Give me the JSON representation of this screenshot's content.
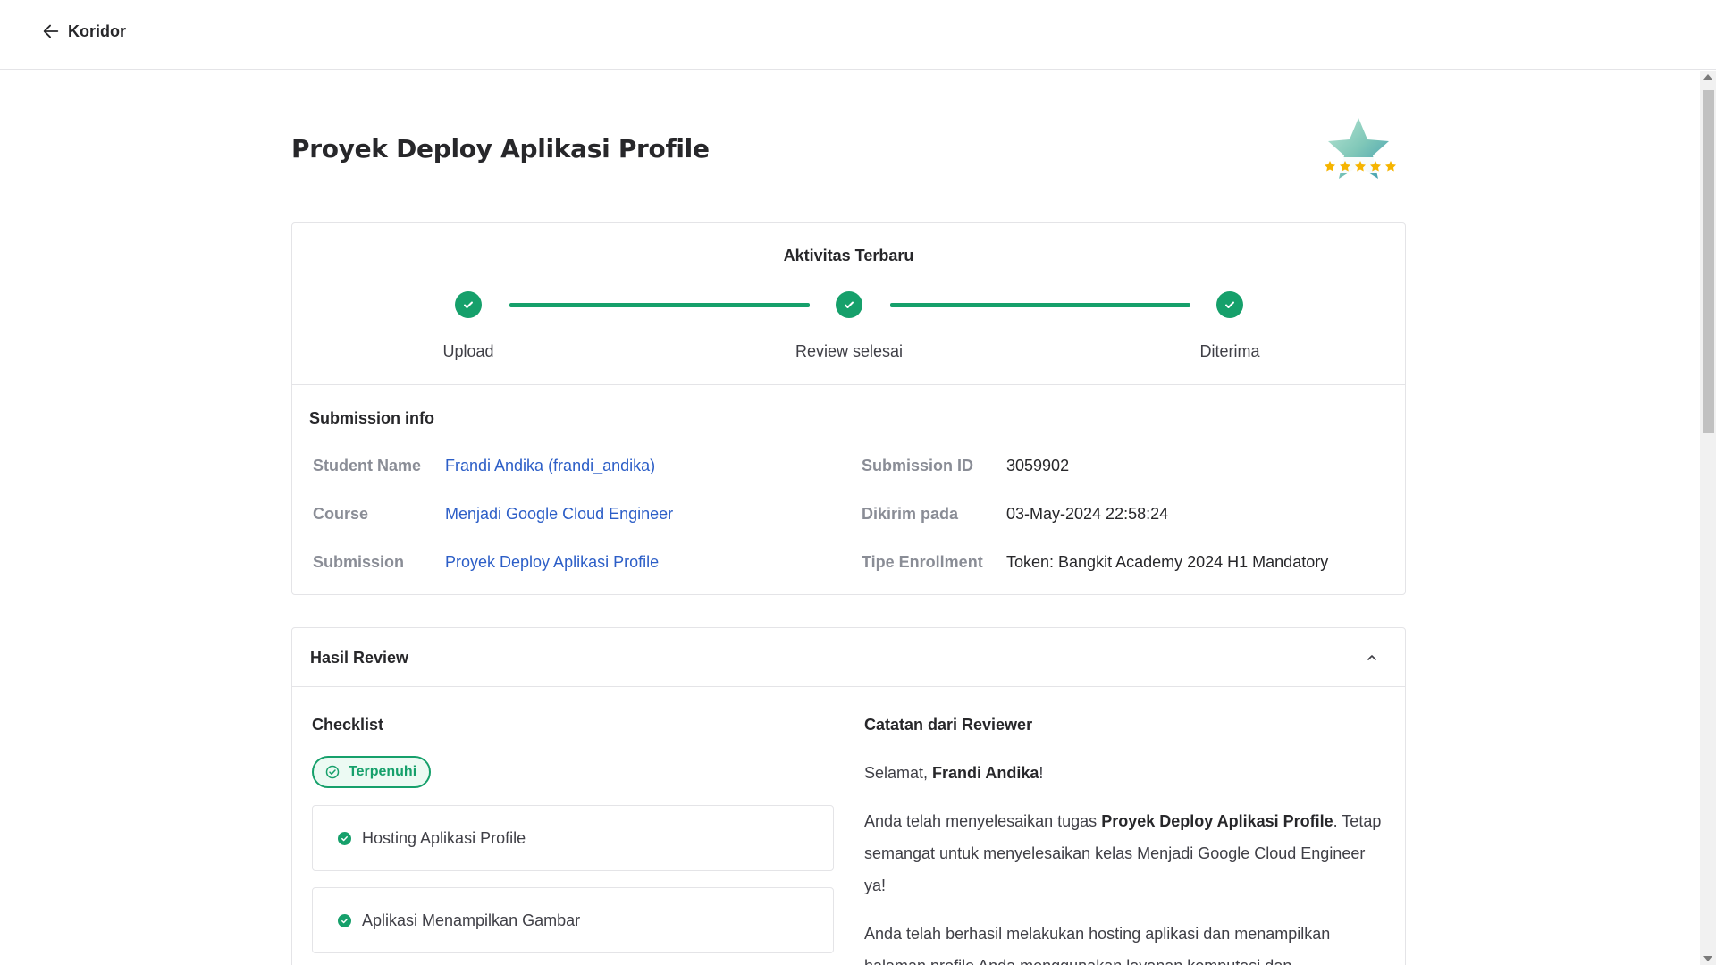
{
  "header": {
    "back_label": "Koridor"
  },
  "page": {
    "title": "Proyek Deploy Aplikasi Profile",
    "badge_icon": "star-rating-badge-icon"
  },
  "activity": {
    "title": "Aktivitas Terbaru",
    "steps": [
      {
        "label": "Upload",
        "status": "done"
      },
      {
        "label": "Review selesai",
        "status": "done"
      },
      {
        "label": "Diterima",
        "status": "done"
      }
    ],
    "accent_color": "#16a06b"
  },
  "submission_info": {
    "title": "Submission info",
    "student_name_label": "Student Name",
    "student_name_value": "Frandi Andika (frandi_andika)",
    "course_label": "Course",
    "course_value": "Menjadi Google Cloud Engineer",
    "submission_label": "Submission",
    "submission_value": "Proyek Deploy Aplikasi Profile",
    "submission_id_label": "Submission ID",
    "submission_id_value": "3059902",
    "sent_at_label": "Dikirim pada",
    "sent_at_value": "03-May-2024 22:58:24",
    "enrollment_label": "Tipe Enrollment",
    "enrollment_value": "Token: Bangkit Academy 2024 H1 Mandatory"
  },
  "review": {
    "title": "Hasil Review",
    "checklist_title": "Checklist",
    "status_pill": "Terpenuhi",
    "checklist_items": [
      "Hosting Aplikasi Profile",
      "Aplikasi Menampilkan Gambar"
    ],
    "notes_title": "Catatan dari Reviewer",
    "notes": {
      "greeting_prefix": "Selamat, ",
      "greeting_name": "Frandi Andika",
      "greeting_suffix": "!",
      "p1_prefix": "Anda telah menyelesaikan tugas ",
      "p1_bold": "Proyek Deploy Aplikasi Profile",
      "p1_suffix": ". Tetap semangat untuk menyelesaikan kelas Menjadi Google Cloud Engineer ya!",
      "p2": "Anda telah berhasil melakukan hosting aplikasi dan menampilkan halaman profile Anda menggunakan layanan komputasi dan"
    }
  }
}
